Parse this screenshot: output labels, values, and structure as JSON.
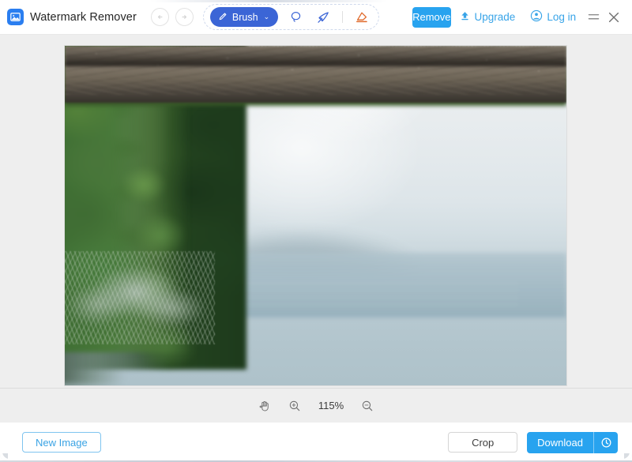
{
  "app": {
    "title": "Watermark Remover",
    "logo_icon": "image-photo-icon"
  },
  "header": {
    "undo": {
      "icon": "undo-arrow-icon",
      "label": "Undo"
    },
    "redo": {
      "icon": "redo-arrow-icon",
      "label": "Redo"
    },
    "tools": {
      "brush": {
        "label": "Brush",
        "icon": "brush-icon",
        "caret": "⌄",
        "active": true,
        "color": "#3b65d6"
      },
      "lasso": {
        "icon": "lasso-icon",
        "label": "Lasso",
        "color": "#3b65d6"
      },
      "wand": {
        "icon": "magic-wand-icon",
        "label": "Magic Wand",
        "color": "#3b65d6"
      },
      "eraser": {
        "icon": "eraser-icon",
        "label": "Eraser",
        "color": "#e06a2b"
      }
    },
    "remove_button": {
      "label": "Remove",
      "color": "#28a3ef"
    },
    "upgrade": {
      "label": "Upgrade",
      "icon": "upload-arrow-icon",
      "color": "#38a4e8"
    },
    "login": {
      "label": "Log in",
      "icon": "user-circle-icon",
      "color": "#38a4e8"
    },
    "menu": {
      "icon": "hamburger-menu-icon"
    },
    "close": {
      "icon": "close-x-icon"
    }
  },
  "canvas": {
    "image_alt": "Blurred lake and mountain landscape framed by conifer trees with gravel foreground",
    "background_color": "#eeeeee"
  },
  "zoom_bar": {
    "pan": {
      "icon": "hand-pan-icon",
      "label": "Pan"
    },
    "zoom_in": {
      "icon": "zoom-in-icon",
      "label": "Zoom in"
    },
    "level": "115%",
    "zoom_out": {
      "icon": "zoom-out-icon",
      "label": "Zoom out"
    }
  },
  "footer": {
    "new_image": {
      "label": "New Image"
    },
    "crop": {
      "label": "Crop"
    },
    "download": {
      "label": "Download",
      "icon": "clock-history-icon",
      "color": "#28a3ef"
    }
  }
}
